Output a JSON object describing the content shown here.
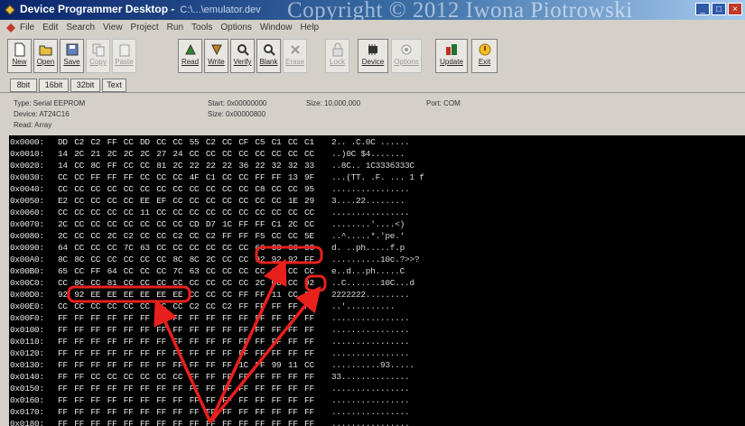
{
  "window": {
    "title": "Device Programmer Desktop -",
    "subtitle": "C:\\...\\emulator.dev",
    "watermark": "Copyright © 2012 Iwona Piotrowski"
  },
  "menu": [
    "File",
    "Edit",
    "Search",
    "View",
    "Project",
    "Run",
    "Tools",
    "Options",
    "Window",
    "Help"
  ],
  "toolbar": [
    {
      "label": "New",
      "enabled": true,
      "icon": "new-icon"
    },
    {
      "label": "Open",
      "enabled": true,
      "icon": "open-icon"
    },
    {
      "label": "Save",
      "enabled": true,
      "icon": "save-icon"
    },
    {
      "label": "Copy",
      "enabled": false,
      "icon": "copy-icon"
    },
    {
      "label": "Paste",
      "enabled": false,
      "icon": "paste-icon"
    },
    {
      "label": "Read",
      "enabled": true,
      "icon": "read-icon"
    },
    {
      "label": "Write",
      "enabled": true,
      "icon": "write-icon"
    },
    {
      "label": "Verify",
      "enabled": true,
      "icon": "verify-icon"
    },
    {
      "label": "Blank",
      "enabled": true,
      "icon": "blank-icon"
    },
    {
      "label": "Erase",
      "enabled": false,
      "icon": "erase-icon"
    },
    {
      "label": "Lock",
      "enabled": false,
      "icon": "lock-icon"
    },
    {
      "label": "Device",
      "enabled": true,
      "icon": "device-icon"
    },
    {
      "label": "Options",
      "enabled": false,
      "icon": "options-icon"
    },
    {
      "label": "Update",
      "enabled": true,
      "icon": "update-icon"
    },
    {
      "label": "Exit",
      "enabled": true,
      "icon": "exit-icon"
    }
  ],
  "tabs": [
    "8bit",
    "16bit",
    "32bit",
    "Text"
  ],
  "info": {
    "type": "Type: Serial EEPROM",
    "device": "Device: AT24C16",
    "read": "Read: Array",
    "start": "Start: 0x00000000",
    "size": "Size: 0x00000800",
    "sizeb": "Size: 10,000,000",
    "port": "Port: COM"
  },
  "hex": [
    {
      "addr": "0x0000:",
      "bytes": "DD C2 C2 FF CC DD CC CC 55 C2 CC CF C5 C1 CC C1",
      "ascii": "2.. .C.0C ......"
    },
    {
      "addr": "0x0010:",
      "bytes": "14 2C 21 2C 2C 2C 27 24 CC CC CC CC CC CC CC CC",
      "ascii": "..)0C $4......."
    },
    {
      "addr": "0x0020:",
      "bytes": "14 CC 8C FF CC CC 81 2C 22 22 22 36 22 32 32 33",
      "ascii": "..8C.. 1C3336333C"
    },
    {
      "addr": "0x0030:",
      "bytes": "CC CC FF FF FF CC CC CC 4F C1 CC CC FF FF 13 9F",
      "ascii": "...(TT. .F. ... 1 f"
    },
    {
      "addr": "0x0040:",
      "bytes": "CC CC CC CC CC CC CC CC CC CC CC CC C8 CC CC 95",
      "ascii": "................"
    },
    {
      "addr": "0x0050:",
      "bytes": "E2 CC CC CC CC EE EF CC CC CC CC CC CC CC 1E 29",
      "ascii": "3....22........"
    },
    {
      "addr": "0x0060:",
      "bytes": "CC CC CC CC CC 11 CC CC CC CC CC CC CC CC CC CC",
      "ascii": "................"
    },
    {
      "addr": "0x0070:",
      "bytes": "2C CC CC CC CC CC CC CC CD D7 1C FF FF C1 2C CC",
      "ascii": "........'....<)"
    },
    {
      "addr": "0x0080:",
      "bytes": "2C CC CC 2C C2 CC CC C2 CC C2 FF FF F5 CC CC 5E",
      "ascii": "..^.....*.'pe.'"
    },
    {
      "addr": "0x0090:",
      "bytes": "64 CC CC CC 7C 63 CC CC CC CC CC CC 66 CC 66 CC",
      "ascii": "d. ..ph.....f.p"
    },
    {
      "addr": "0x00A0:",
      "bytes": "8C 8C CC CC CC CC CC 8C 8C 2C CC CC 92 92 92 FF",
      "ascii": "..........10c.?>>?"
    },
    {
      "addr": "0x00B0:",
      "bytes": "65 CC FF 64 CC CC CC 7C 63 CC CC CC CC CC CC CC",
      "ascii": "e..d...ph.....C"
    },
    {
      "addr": "0x00C0:",
      "bytes": "CC 8C CC 81 CC CC CC CC CC CC CC CC 2C CC CC 92",
      "ascii": "..C.......10C...d"
    },
    {
      "addr": "0x00D0:",
      "bytes": "92 92 EE EE EE EE EE EE CC CC CC FF FF 11 CC 8C",
      "ascii": "2222222........."
    },
    {
      "addr": "0x00E0:",
      "bytes": "CC CC CC CC CC CC CC CC C2 CC C2 FF FF FF FF FF",
      "ascii": "..'.........."
    },
    {
      "addr": "0x00F0:",
      "bytes": "FF FF FF FF FF FF FF FF FF FF FF FF FF FF FF FF",
      "ascii": "................"
    },
    {
      "addr": "0x0100:",
      "bytes": "FF FF FF FF FF FF FF FF FF FF FF FF FF FF FF FF",
      "ascii": "................"
    },
    {
      "addr": "0x0110:",
      "bytes": "FF FF FF FF FF FF FF FF FF FF FF FF FF FF FF FF",
      "ascii": "................"
    },
    {
      "addr": "0x0120:",
      "bytes": "FF FF FF FF FF FF FF FF FF FF FF FF FF FF FF FF",
      "ascii": "................"
    },
    {
      "addr": "0x0130:",
      "bytes": "FF FF FF FF FF FF FF FF FF FF FF 1C FF 99 11 CC",
      "ascii": "..........93....."
    },
    {
      "addr": "0x0140:",
      "bytes": "FF FF CC CC CC CC CC CC FF FF FF FF FF FF FF FF",
      "ascii": "33.............."
    },
    {
      "addr": "0x0150:",
      "bytes": "FF FF FF FF FF FF FF FF FF FF FF FF FF FF FF FF",
      "ascii": "................"
    },
    {
      "addr": "0x0160:",
      "bytes": "FF FF FF FF FF FF FF FF FF FF FF FF FF FF FF FF",
      "ascii": "................"
    },
    {
      "addr": "0x0170:",
      "bytes": "FF FF FF FF FF FF FF FF FF FF FF FF FF FF FF FF",
      "ascii": "................"
    },
    {
      "addr": "0x0180:",
      "bytes": "FF FF FF FF FF FF FF FF FF FF FF FF FF FF FF FF",
      "ascii": "................"
    }
  ],
  "colors": {
    "annotation": "#e8201c",
    "titlebar": "#0a246a",
    "hex_bg": "#000000"
  }
}
